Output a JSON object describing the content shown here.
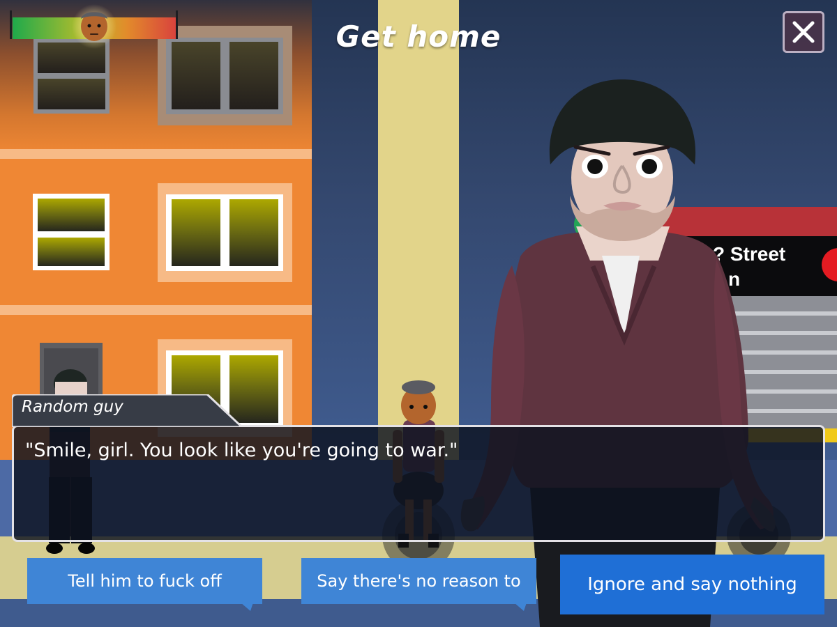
{
  "header": {
    "title": "Get home"
  },
  "close": {
    "label": "×"
  },
  "dialog": {
    "speaker": "Random guy",
    "text": "\"Smile, girl. You look like you're going to war.\""
  },
  "choices": [
    {
      "label": "Tell him to fuck off"
    },
    {
      "label": "Say there's no reason to"
    },
    {
      "label": "Ignore and say nothing"
    }
  ],
  "sign": {
    "line1": "? Street",
    "line2": "n"
  },
  "mood": {
    "level": 0.5
  },
  "colors": {
    "building": "#ef8734",
    "street": "#3f5b8e",
    "choice": "#3f85d6",
    "choice_selected": "#1f6fd6",
    "subway_red": "#b83238"
  }
}
